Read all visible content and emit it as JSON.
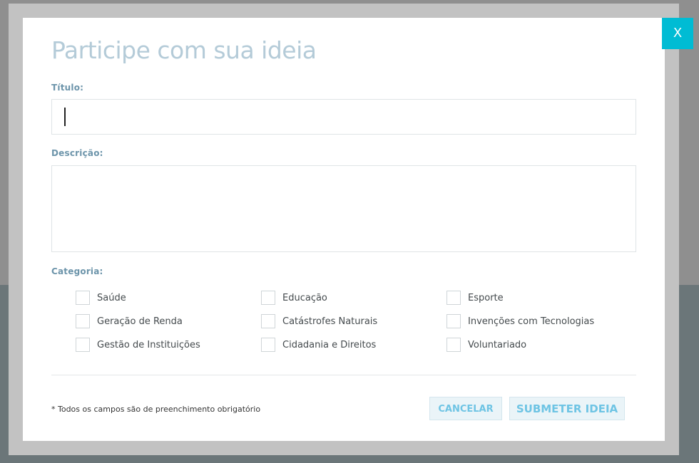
{
  "modal": {
    "title": "Participe com sua ideia",
    "close_label": "X",
    "title_field": {
      "label": "Título:",
      "value": ""
    },
    "description_field": {
      "label": "Descrição:",
      "value": ""
    },
    "category": {
      "label": "Categoria:",
      "options": [
        "Saúde",
        "Educação",
        "Esporte",
        "Geração de Renda",
        "Catástrofes Naturais",
        "Invenções com Tecnologias",
        "Gestão de Instituições",
        "Cidadania e Direitos",
        "Voluntariado"
      ]
    },
    "required_note": "* Todos os campos são de preenchimento obrigatório",
    "cancel_label": "CANCELAR",
    "submit_label": "SUBMETER IDEIA"
  },
  "colors": {
    "accent": "#00bcd4",
    "title": "#b4cbd8",
    "label": "#6c94aa",
    "button_text": "#6ec4e4"
  }
}
